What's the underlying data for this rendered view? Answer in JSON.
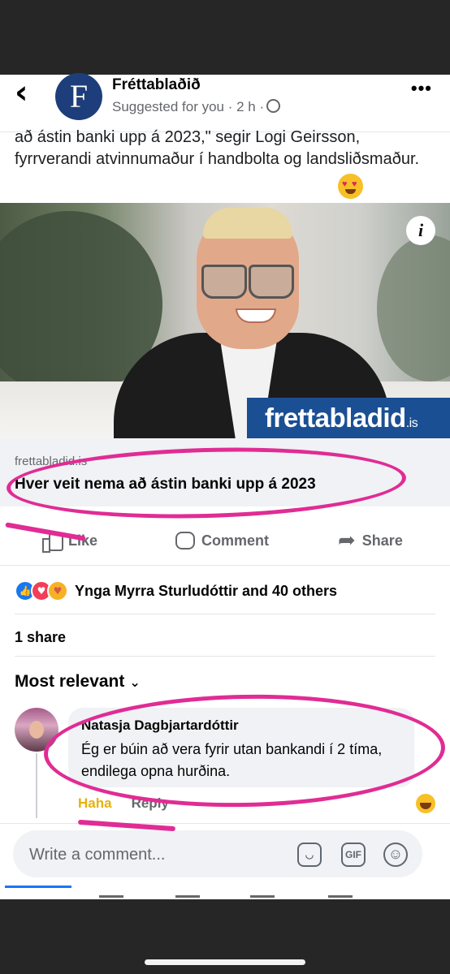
{
  "header": {
    "page_name": "Fréttablaðið",
    "logo_letter": "F",
    "meta": "Suggested for you · 2 h ·"
  },
  "post": {
    "text": "að ástin banki upp á 2023,\" segir Logi Geirsson, fyrrverandi atvinnumaður í handbolta og landsliðsmaður.",
    "image_brand": "frettabladid",
    "image_brand_suffix": ".is",
    "info_label": "i"
  },
  "link": {
    "domain": "frettabladid.is",
    "headline": "Hver veit nema að ástin banki upp á 2023"
  },
  "actions": {
    "like": "Like",
    "comment": "Comment",
    "share": "Share"
  },
  "reactions": {
    "text": "Ynga Myrra Sturludóttir and 40 others",
    "types": [
      "like",
      "love",
      "care"
    ]
  },
  "shares": "1 share",
  "sort": {
    "label": "Most relevant"
  },
  "comment": {
    "author": "Natasja Dagbjartardóttir",
    "text": "Ég er búin að vera fyrir utan bankandi í 2 tíma, endilega opna hurðina.",
    "haha_label": "Haha",
    "reply_label": "Reply"
  },
  "composer": {
    "placeholder": "Write a comment...",
    "gif_label": "GIF"
  },
  "colors": {
    "annotation": "#e02c94",
    "facebook_blue": "#1877f2",
    "brand_blue": "#1b4f93"
  }
}
